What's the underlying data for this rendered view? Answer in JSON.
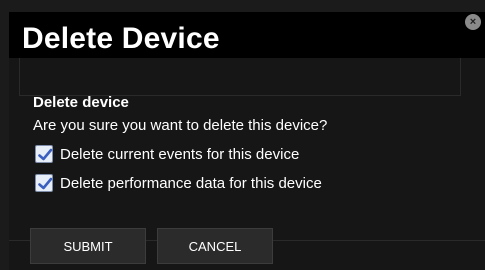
{
  "dialog": {
    "title": "Delete Device",
    "close_icon": "close-icon",
    "heading": "Delete device",
    "question": "Are you sure you want to delete this device?",
    "options": [
      {
        "label": "Delete current events for this device",
        "checked": true
      },
      {
        "label": "Delete performance data for this device",
        "checked": true
      }
    ],
    "buttons": {
      "submit": "SUBMIT",
      "cancel": "CANCEL"
    }
  },
  "colors": {
    "background": "#1b1b1b",
    "titlebar": "#000000",
    "text": "#ffffff",
    "button": "#2b2b2b",
    "checkbox": "#e8eef7",
    "check": "#3a5fbf"
  }
}
